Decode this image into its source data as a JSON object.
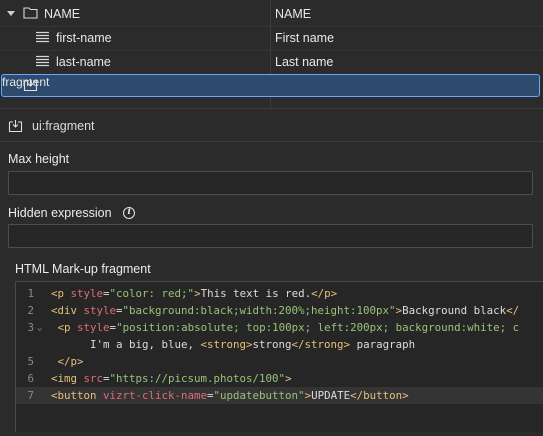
{
  "tree": {
    "columns": [
      "NAME",
      "NAME"
    ],
    "rows": [
      {
        "name": "first-name",
        "value": "First name"
      },
      {
        "name": "last-name",
        "value": "Last name"
      }
    ],
    "selected": {
      "name": "fragment",
      "value": ""
    }
  },
  "component": {
    "title": "ui:fragment"
  },
  "fields": {
    "max_height": {
      "label": "Max height",
      "value": ""
    },
    "hidden_expression": {
      "label": "Hidden expression",
      "value": ""
    },
    "html_fragment": {
      "label": "HTML Mark-up fragment"
    }
  },
  "code": {
    "line_numbers": [
      "1",
      "2",
      "3",
      "",
      "5",
      "6",
      "7"
    ],
    "fold_marker": "⌄",
    "lines": [
      [
        {
          "t": "tag",
          "s": "<p "
        },
        {
          "t": "attr",
          "s": "style"
        },
        {
          "t": "text",
          "s": "="
        },
        {
          "t": "str",
          "s": "\"color: red;\""
        },
        {
          "t": "tag",
          "s": ">"
        },
        {
          "t": "text",
          "s": "This text is red."
        },
        {
          "t": "tag",
          "s": "</p>"
        }
      ],
      [
        {
          "t": "tag",
          "s": "<div "
        },
        {
          "t": "attr",
          "s": "style"
        },
        {
          "t": "text",
          "s": "="
        },
        {
          "t": "str",
          "s": "\"background:black;width:200%;height:100px\""
        },
        {
          "t": "tag",
          "s": ">"
        },
        {
          "t": "text",
          "s": "Background black"
        },
        {
          "t": "tag",
          "s": "</"
        }
      ],
      [
        {
          "t": "text",
          "s": " "
        },
        {
          "t": "tag",
          "s": "<p "
        },
        {
          "t": "attr",
          "s": "style"
        },
        {
          "t": "text",
          "s": "="
        },
        {
          "t": "str",
          "s": "\"position:absolute; top:100px; left:200px; background:white; c"
        }
      ],
      [
        {
          "t": "text",
          "s": "      I'm a big, blue, "
        },
        {
          "t": "tag",
          "s": "<strong>"
        },
        {
          "t": "text",
          "s": "strong"
        },
        {
          "t": "tag",
          "s": "</strong>"
        },
        {
          "t": "text",
          "s": " paragraph"
        }
      ],
      [
        {
          "t": "text",
          "s": " "
        },
        {
          "t": "tag",
          "s": "</p>"
        }
      ],
      [
        {
          "t": "tag",
          "s": "<img "
        },
        {
          "t": "attr",
          "s": "src"
        },
        {
          "t": "text",
          "s": "="
        },
        {
          "t": "str",
          "s": "\"https://picsum.photos/100\""
        },
        {
          "t": "tag",
          "s": ">"
        }
      ],
      [
        {
          "t": "tag",
          "s": "<button "
        },
        {
          "t": "attr",
          "s": "vizrt-click-name"
        },
        {
          "t": "text",
          "s": "="
        },
        {
          "t": "str",
          "s": "\"updatebutton\""
        },
        {
          "t": "tag",
          "s": ">"
        },
        {
          "t": "text",
          "s": "UPDATE"
        },
        {
          "t": "tag",
          "s": "</button>"
        }
      ]
    ]
  },
  "colors": {
    "selection_outline": "#6aa6ff",
    "selection_fill": "#2e4a6d",
    "code_tag": "#e5c07b",
    "code_attr": "#e06c75",
    "code_string": "#98c379"
  },
  "icons": {
    "expand": "chevron-down-icon",
    "folder": "folder-icon",
    "field": "text-lines-icon",
    "fragment": "fragment-icon",
    "info": "info-icon"
  }
}
